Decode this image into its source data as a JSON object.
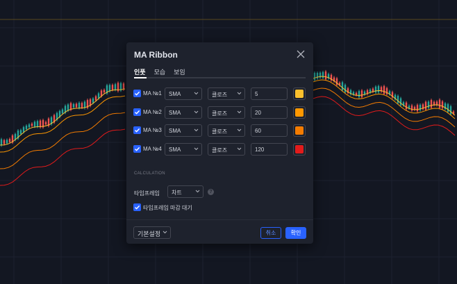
{
  "dialog": {
    "title": "MA Ribbon",
    "tabs": [
      {
        "label": "인풋",
        "active": true
      },
      {
        "label": "모습",
        "active": false
      },
      {
        "label": "보임",
        "active": false
      }
    ],
    "ma_rows": [
      {
        "label": "MA №1",
        "checked": true,
        "type": "SMA",
        "source": "클로즈",
        "length": "5",
        "color": "#fbc02d"
      },
      {
        "label": "MA №2",
        "checked": true,
        "type": "SMA",
        "source": "클로즈",
        "length": "20",
        "color": "#ff9800"
      },
      {
        "label": "MA №3",
        "checked": true,
        "type": "SMA",
        "source": "클로즈",
        "length": "60",
        "color": "#f57c00"
      },
      {
        "label": "MA №4",
        "checked": true,
        "type": "SMA",
        "source": "클로즈",
        "length": "120",
        "color": "#e31b1b"
      }
    ],
    "section_label": "CALCULATION",
    "timeframe": {
      "label": "타임프레임",
      "value": "차트"
    },
    "wait_close": {
      "label": "타임프레임 마감 대기",
      "checked": true
    },
    "footer": {
      "defaults_label": "기본설정",
      "cancel_label": "취소",
      "ok_label": "확인"
    }
  },
  "colors": {
    "background": "#131722",
    "dialog_bg": "#1e222d",
    "accent": "#2962ff",
    "candle_up": "#26a69a",
    "candle_down": "#ef5350"
  }
}
